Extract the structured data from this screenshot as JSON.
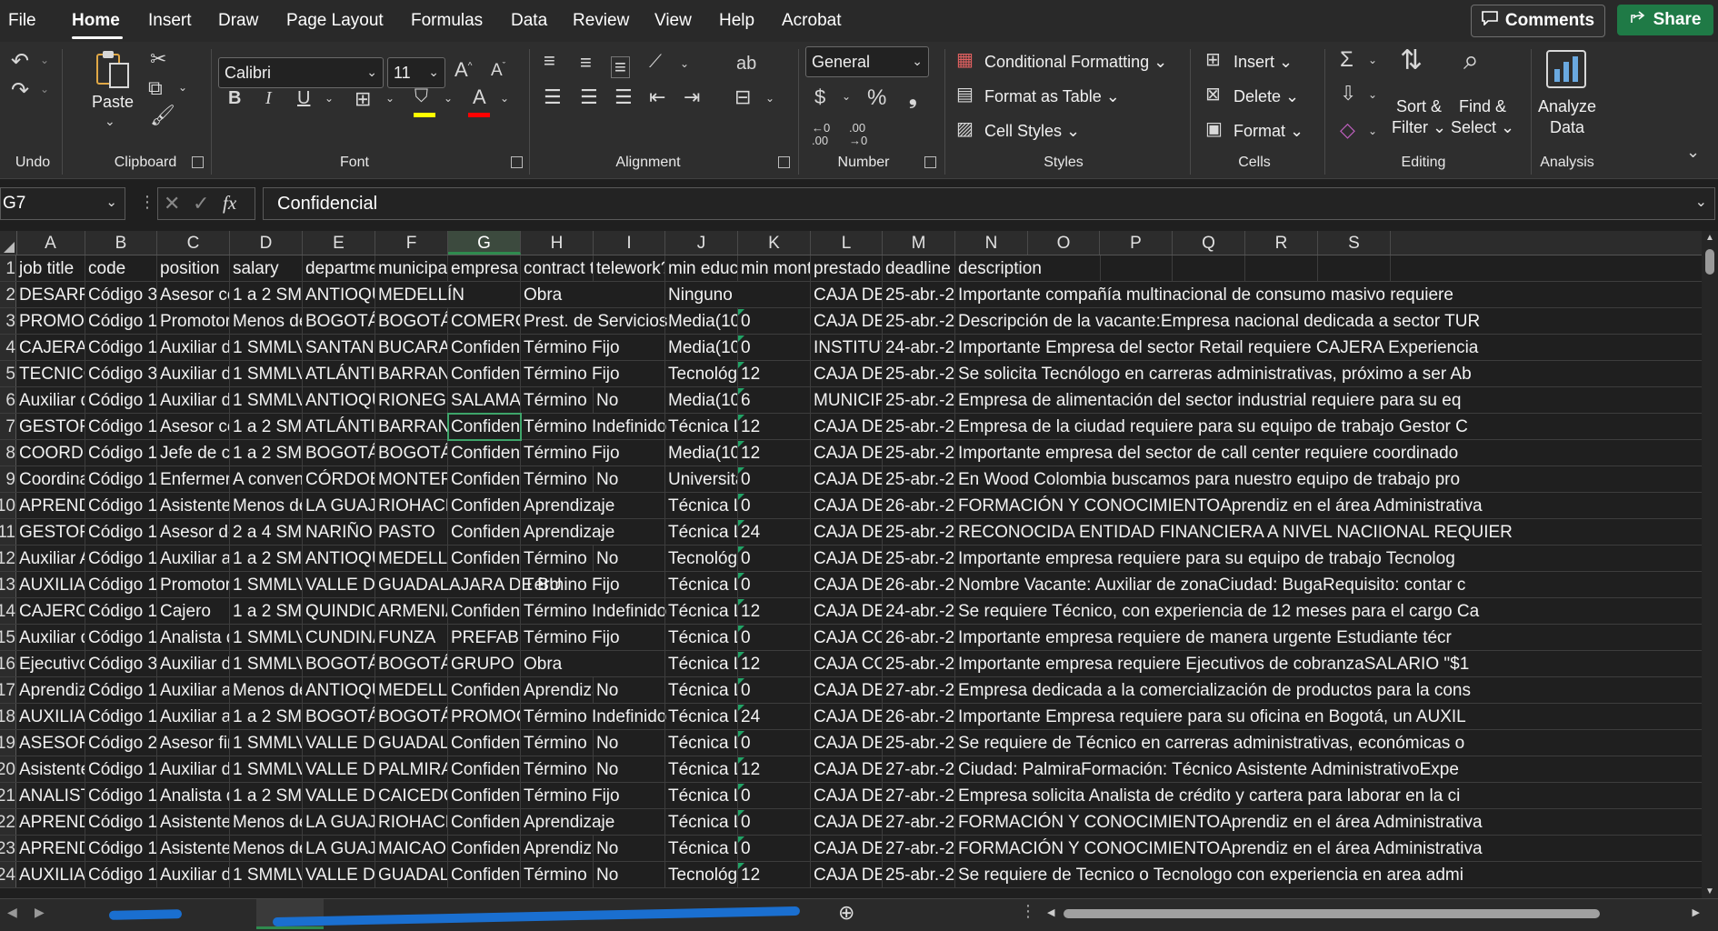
{
  "menu": {
    "file": "File",
    "home": "Home",
    "insert": "Insert",
    "draw": "Draw",
    "page_layout": "Page Layout",
    "formulas": "Formulas",
    "data": "Data",
    "review": "Review",
    "view": "View",
    "help": "Help",
    "acrobat": "Acrobat",
    "comments": "Comments",
    "share": "Share"
  },
  "ribbon": {
    "undo_label": "Undo",
    "paste": "Paste",
    "clipboard_label": "Clipboard",
    "font_name": "Calibri",
    "font_size": "11",
    "font_label": "Font",
    "alignment_label": "Alignment",
    "number_format": "General",
    "number_label": "Number",
    "conditional_formatting": "Conditional Formatting",
    "format_as_table": "Format as Table",
    "cell_styles": "Cell Styles",
    "styles_label": "Styles",
    "cells_insert": "Insert",
    "cells_delete": "Delete",
    "cells_format": "Format",
    "cells_label": "Cells",
    "sort_filter_1": "Sort &",
    "sort_filter_2": "Filter",
    "find_select_1": "Find &",
    "find_select_2": "Select",
    "editing_label": "Editing",
    "analyze_1": "Analyze",
    "analyze_2": "Data",
    "analysis_label": "Analysis",
    "colors": {
      "fill_color": "#ffff00",
      "font_color": "#ff0000"
    }
  },
  "formula_bar": {
    "name_box": "G7",
    "fx": "fx",
    "content": "Confidencial"
  },
  "columns": [
    "A",
    "B",
    "C",
    "D",
    "E",
    "F",
    "G",
    "H",
    "I",
    "J",
    "K",
    "L",
    "M",
    "N",
    "O",
    "P",
    "Q",
    "R",
    "S"
  ],
  "row_numbers": [
    "1",
    "2",
    "3",
    "4",
    "5",
    "6",
    "7",
    "8",
    "9",
    "10",
    "11",
    "12",
    "13",
    "14",
    "15",
    "16",
    "17",
    "18",
    "19",
    "20",
    "21",
    "22",
    "23",
    "24"
  ],
  "header_row": [
    "job title",
    "code",
    "position",
    "salary",
    "departme",
    "municipali",
    "empresa",
    "contract ty",
    "telework?",
    "min educa",
    "min montl",
    "prestador",
    "deadline",
    "description"
  ],
  "rows": [
    [
      "DESARROL",
      "Código 37",
      "Asesor co",
      "1 a 2 SMM",
      "ANTIOQUI",
      "MEDELLÍN",
      "",
      "Obra",
      "",
      "Ninguno",
      "",
      "CAJA DE C",
      "25-abr.-20",
      "Importante compañía multinacional de consumo masivo requiere"
    ],
    [
      "PROMOTC",
      "Código 16",
      "Promotor",
      "Menos de",
      "BOGOTÁ,",
      "BOGOTÁ,",
      "COMERCIA",
      "Prest. de Servicios",
      "",
      "Media(10-",
      "0",
      "CAJA DE C",
      "25-abr.-20",
      "Descripción de la vacante:Empresa nacional dedicada a sector TUR"
    ],
    [
      "CAJERA",
      "Código 16",
      "Auxiliar de",
      "1 SMMLV",
      "SANTANDI",
      "BUCARAM",
      "Confidenc",
      "Término Fijo",
      "",
      "Media(10-",
      "0",
      "INSTITUTC",
      "24-abr.-20",
      "Importante Empresa del sector Retail requiere CAJERA Experiencia"
    ],
    [
      "TECNICO E",
      "Código 31",
      "Auxiliar de",
      "1 SMMLV",
      "ATLÁNTIC",
      "BARRANQ",
      "Confidenc",
      "Término Fijo",
      "",
      "Tecnológic",
      "12",
      "CAJA DE C",
      "25-abr.-20",
      "Se solicita Tecnólogo en carreras administrativas, próximo a ser Ab"
    ],
    [
      "Auxiliar de",
      "Código 16",
      "Auxiliar de",
      "1 SMMLV",
      "ANTIOQUI",
      "RIONEGRO",
      "SALAMAN",
      "Término F",
      "No",
      "Media(10-",
      "6",
      "MUNICIPIC",
      "25-abr.-20",
      "Empresa de alimentación del sector industrial requiere para su eq"
    ],
    [
      "GESTOR C",
      "Código 16",
      "Asesor co",
      "1 a 2 SMM",
      "ATLÁNTIC",
      "BARRANQ",
      "Confidenc",
      "Término Indefinido",
      "",
      "Técnica La",
      "12",
      "CAJA DE C",
      "25-abr.-20",
      "Empresa de la ciudad requiere para su equipo de trabajo Gestor C"
    ],
    [
      "COORDINA",
      "Código 16",
      "Jefe de ca",
      "1 a 2 SMM",
      "BOGOTÁ,",
      "BOGOTÁ,",
      "Confidenc",
      "Término Fijo",
      "",
      "Media(10-",
      "12",
      "CAJA DE C",
      "25-abr.-20",
      "Importante empresa del sector de call center requiere coordinado"
    ],
    [
      "Coordinac",
      "Código 16",
      "Enfermerc",
      "A conveni",
      "CÓRDOBA",
      "MONTERÍA",
      "Confidenc",
      "Término F",
      "No",
      "Universita",
      "0",
      "CAJA DE C",
      "25-abr.-20",
      "En Wood Colombia buscamos para nuestro equipo de trabajo pro"
    ],
    [
      "APRENDIZ",
      "Código 16",
      "Asistente",
      "Menos de",
      "LA GUAJIR",
      "RIOHACHA",
      "Confidenc",
      "Aprendizaje",
      "",
      "Técnica La",
      "0",
      "CAJA DE C",
      "26-abr.-20",
      "FORMACIÓN Y CONOCIMIENTOAprendiz en el área  Administrativa"
    ],
    [
      "GESTOR D",
      "Código 16",
      "Asesor de",
      "2 a 4 SMM",
      "NARIÑO",
      "PASTO",
      "Confidenc",
      "Aprendizaje",
      "",
      "Técnica La",
      "24",
      "CAJA DE C",
      "25-abr.-20",
      "RECONOCIDA ENTIDAD FINANCIERA  A NIVEL NACIIONAL REQUIER"
    ],
    [
      "Auxiliar Ac",
      "Código 16",
      "Auxiliar ac",
      "1 a 2 SMM",
      "ANTIOQUI",
      "MEDELLÍN",
      "Confidenc",
      "Término In",
      "No",
      "Tecnológic",
      "0",
      "CAJA DE C",
      "25-abr.-20",
      "Importante empresa requiere para su equipo de trabajo Tecnolog"
    ],
    [
      "AUXILIAR I",
      "Código 16",
      "Promotor",
      "1 SMMLV",
      "VALLE DEL",
      "GUADALAJARA DE BU",
      "",
      "Término Fijo",
      "",
      "Técnica La",
      "0",
      "CAJA DE C",
      "26-abr.-20",
      "Nombre Vacante: Auxiliar de zonaCiudad: BugaRequisito: contar c"
    ],
    [
      "CAJERO DI",
      "Código 16",
      "Cajero",
      "1 a 2 SMM",
      "QUINDIO",
      "ARMENIA",
      "Confidenc",
      "Término Indefinido",
      "",
      "Técnica La",
      "12",
      "CAJA DE C",
      "24-abr.-20",
      "Se requiere Técnico, con experiencia de 12 meses para el cargo Ca"
    ],
    [
      "Auxiliar de",
      "Código 16",
      "Analista de",
      "1 SMMLV",
      "CUNDINAI",
      "FUNZA",
      "PREFABRIC",
      "Término Fijo",
      "",
      "Técnica La",
      "0",
      "CAJA COL",
      "26-abr.-20",
      "Importante empresa  requiere de manera urgente Estudiante técr"
    ],
    [
      "Ejecutivos",
      "Código 35",
      "Auxiliar de",
      "1 SMMLV",
      "BOGOTÁ,",
      "BOGOTÁ,",
      "GRUPO EM",
      "Obra",
      "",
      "Técnica La",
      "12",
      "CAJA COL",
      "25-abr.-20",
      "Importante empresa requiere Ejecutivos de cobranzaSALARIO \"$1"
    ],
    [
      "Aprendiz A",
      "Código 16",
      "Auxiliar ac",
      "Menos de",
      "ANTIOQUI",
      "MEDELLÍN",
      "Confidenc",
      "Aprendiza",
      "No",
      "Técnica La",
      "0",
      "CAJA DE C",
      "27-abr.-20",
      "Empresa dedicada a la comercialización de productos para la cons"
    ],
    [
      "AUXILIAR",
      "Código 16",
      "Auxiliar ac",
      "1 a 2 SMM",
      "BOGOTÁ,",
      "BOGOTÁ,",
      "PROMOCI",
      "Término Indefinido",
      "",
      "Técnica La",
      "24",
      "CAJA DE C",
      "26-abr.-20",
      "Importante Empresa requiere para su oficina en Bogotá, un AUXIL"
    ],
    [
      "ASESOR D",
      "Código 21",
      "Asesor fin",
      "1 SMMLV",
      "VALLE DEL",
      "GUADALA.",
      "Confidenc",
      "Término F",
      "No",
      "Técnica La",
      "0",
      "CAJA DE C",
      "25-abr.-20",
      "Se requiere de Técnico en carreras administrativas, económicas o"
    ],
    [
      "Asistente",
      "Código 16",
      "Auxiliar de",
      "1 SMMLV",
      "VALLE DEL",
      "PALMIRA",
      "Confidenc",
      "Término F",
      "No",
      "Técnica La",
      "12",
      "CAJA DE C",
      "27-abr.-20",
      "Ciudad: PalmiraFormación:  Técnico Asistente AdministrativoExpe"
    ],
    [
      "ANALISTA",
      "Código 16",
      "Analista de",
      "1 a 2 SMM",
      "VALLE DEL",
      "CAICEDON",
      "Confidenc",
      "Término Fijo",
      "",
      "Técnica La",
      "0",
      "CAJA DE C",
      "27-abr.-20",
      "Empresa solicita Analista de crédito y cartera para laborar en la ci"
    ],
    [
      "APRENDIZ",
      "Código 16",
      "Asistente",
      "Menos de",
      "LA GUAJIR",
      "RIOHACHA",
      "Confidenc",
      "Aprendizaje",
      "",
      "Técnica La",
      "0",
      "CAJA DE C",
      "27-abr.-20",
      "FORMACIÓN Y CONOCIMIENTOAprendiz en el área  Administrativa"
    ],
    [
      "APRENDIZ",
      "Código 16",
      "Asistente",
      "Menos de",
      "LA GUAJIR",
      "MAICAO",
      "Confidenc",
      "Aprendiza",
      "No",
      "Técnica La",
      "0",
      "CAJA DE C",
      "27-abr.-20",
      "FORMACIÓN Y CONOCIMIENTOAprendiz en el área  Administrativa"
    ],
    [
      "AUXILIAR",
      "Código 16",
      "Auxiliar de",
      "1 SMMLV",
      "VALLE DEL",
      "GUADALA.",
      "Confidenc",
      "Término F",
      "No",
      "Tecnológic",
      "12",
      "CAJA DE C",
      "25-abr.-20",
      "Se requiere de Tecnico o Tecnologo con experiencia en  area admi"
    ]
  ],
  "selected_cell": "G7"
}
